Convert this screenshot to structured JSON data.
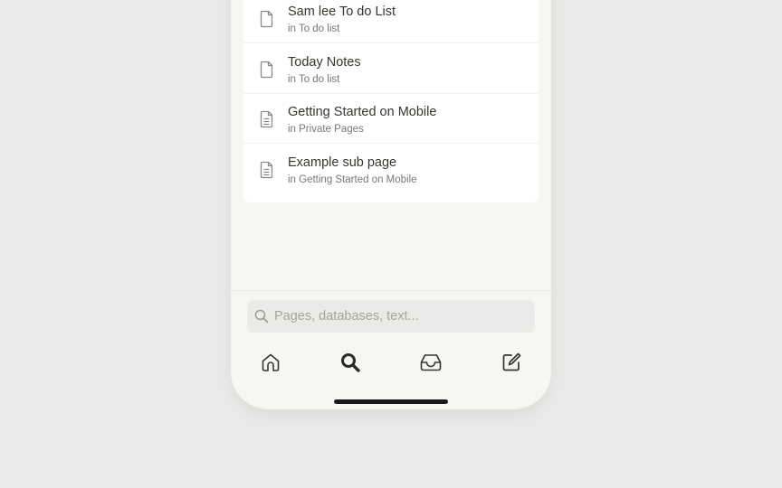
{
  "results": [
    {
      "title": "Sam lee To do List",
      "subtitle": "in To do list",
      "icon": "page-icon"
    },
    {
      "title": "Today Notes",
      "subtitle": "in To do list",
      "icon": "page-icon"
    },
    {
      "title": "Getting Started on Mobile",
      "subtitle": "in Private Pages",
      "icon": "page-text-icon"
    },
    {
      "title": "Example sub page",
      "subtitle": "in Getting Started on Mobile",
      "icon": "page-text-icon"
    }
  ],
  "search": {
    "placeholder": "Pages, databases, text...",
    "value": ""
  },
  "tabs": [
    {
      "name": "home",
      "icon": "home-icon"
    },
    {
      "name": "search",
      "icon": "search-icon",
      "active": true
    },
    {
      "name": "inbox",
      "icon": "inbox-icon"
    },
    {
      "name": "new-page",
      "icon": "compose-icon"
    }
  ],
  "colors": {
    "background": "#e9e9e7",
    "surface": "#f7f6f3",
    "card": "#ffffff",
    "text": "#37352f",
    "muted": "#787774",
    "placeholder": "#a5a4a0"
  }
}
